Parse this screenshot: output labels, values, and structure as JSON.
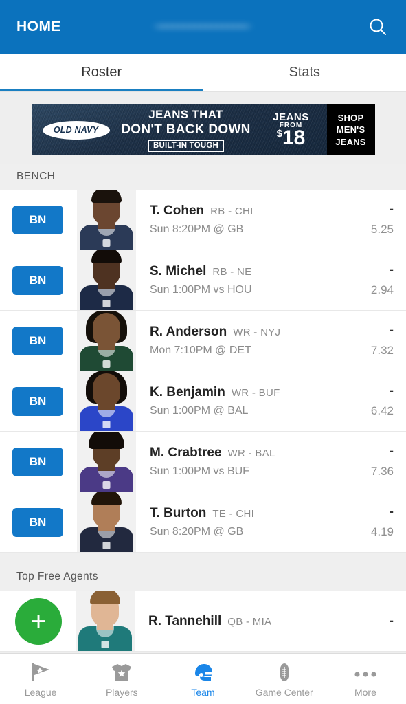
{
  "header": {
    "home_label": "HOME",
    "team_name_redacted": "•••••••••••••••••",
    "search_icon": "search-icon",
    "background_color": "#0b72bd"
  },
  "tabs": [
    {
      "label": "Roster",
      "active": true
    },
    {
      "label": "Stats",
      "active": false
    }
  ],
  "ad": {
    "brand": "OLD NAVY",
    "line1": "JEANS THAT",
    "line2": "DON'T BACK DOWN",
    "tagline": "BUILT-IN TOUGH",
    "price_label": "JEANS",
    "price_from": "FROM",
    "price_currency": "$",
    "price_amount": "18",
    "cta_line1": "SHOP",
    "cta_line2": "MEN'S",
    "cta_line3": "JEANS"
  },
  "bench_section": {
    "title": "BENCH"
  },
  "bench_players": [
    {
      "slot": "BN",
      "name": "T. Cohen",
      "position": "RB",
      "team": "CHI",
      "pos_team": "RB - CHI",
      "game": "Sun 8:20PM @ GB",
      "score": "-",
      "projection": "5.25",
      "jersey_color": "#2b3a57",
      "skin_color": "#6b4630",
      "hair_style": "short",
      "hair_color": "#1a120c"
    },
    {
      "slot": "BN",
      "name": "S. Michel",
      "position": "RB",
      "team": "NE",
      "pos_team": "RB - NE",
      "game": "Sun 1:00PM vs HOU",
      "score": "-",
      "projection": "2.94",
      "jersey_color": "#1d2a46",
      "skin_color": "#4e3221",
      "hair_style": "short",
      "hair_color": "#120c08"
    },
    {
      "slot": "BN",
      "name": "R. Anderson",
      "position": "WR",
      "team": "NYJ",
      "pos_team": "WR - NYJ",
      "game": "Mon 7:10PM @ DET",
      "score": "-",
      "projection": "7.32",
      "jersey_color": "#1f4a34",
      "skin_color": "#7a5436",
      "hair_style": "locks",
      "hair_color": "#15100a"
    },
    {
      "slot": "BN",
      "name": "K. Benjamin",
      "position": "WR",
      "team": "BUF",
      "pos_team": "WR - BUF",
      "game": "Sun 1:00PM @ BAL",
      "score": "-",
      "projection": "6.42",
      "jersey_color": "#2b46c8",
      "skin_color": "#6b472c",
      "hair_style": "locks",
      "hair_color": "#120d09"
    },
    {
      "slot": "BN",
      "name": "M. Crabtree",
      "position": "WR",
      "team": "BAL",
      "pos_team": "WR - BAL",
      "game": "Sun 1:00PM vs BUF",
      "score": "-",
      "projection": "7.36",
      "jersey_color": "#4b3a86",
      "skin_color": "#5d3e26",
      "hair_style": "afro",
      "hair_color": "#120c08"
    },
    {
      "slot": "BN",
      "name": "T. Burton",
      "position": "TE",
      "team": "CHI",
      "pos_team": "TE - CHI",
      "game": "Sun 8:20PM @ GB",
      "score": "-",
      "projection": "4.19",
      "jersey_color": "#22293f",
      "skin_color": "#b07e58",
      "hair_style": "short",
      "hair_color": "#221509"
    }
  ],
  "free_agents_section": {
    "title": "Top Free Agents"
  },
  "free_agents": [
    {
      "add_icon": "plus-icon",
      "name": "R. Tannehill",
      "position": "QB",
      "team": "MIA",
      "pos_team": "QB - MIA",
      "score": "-",
      "jersey_color": "#1f7a7a",
      "skin_color": "#e0b695",
      "hair_style": "short",
      "hair_color": "#8a6034"
    }
  ],
  "bottom_nav": [
    {
      "label": "League",
      "icon": "flag-icon",
      "active": false
    },
    {
      "label": "Players",
      "icon": "jersey-icon",
      "active": false
    },
    {
      "label": "Team",
      "icon": "helmet-icon",
      "active": true
    },
    {
      "label": "Game Center",
      "icon": "football-icon",
      "active": false
    },
    {
      "label": "More",
      "icon": "ellipsis-icon",
      "active": false
    }
  ],
  "colors": {
    "header_blue": "#0b72bd",
    "slot_badge_blue": "#1278c8",
    "tab_underline_blue": "#1a7fc1",
    "add_green": "#2aac3a",
    "nav_active_blue": "#1a86e8"
  }
}
